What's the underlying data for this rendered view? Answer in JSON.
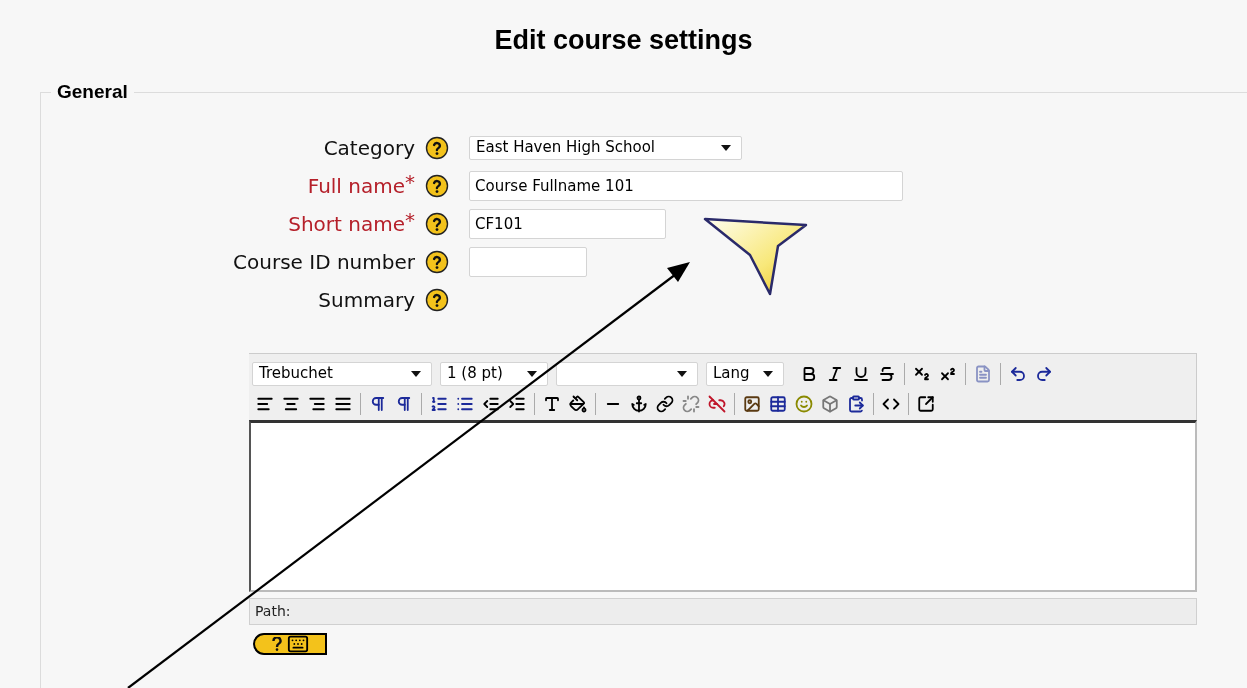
{
  "page_title": "Edit course settings",
  "section": {
    "legend": "General"
  },
  "fields": [
    {
      "kind": "select",
      "label": "Category",
      "required": false,
      "value": "East Haven High School"
    },
    {
      "kind": "text",
      "label": "Full name",
      "required": true,
      "required_mark": "*",
      "value": "Course Fullname 101"
    },
    {
      "kind": "text",
      "label": "Short name",
      "required": true,
      "required_mark": "*",
      "value": "CF101"
    },
    {
      "kind": "text",
      "label": "Course ID number",
      "required": false
    },
    {
      "kind": "editor",
      "label": "Summary",
      "required": false
    }
  ],
  "editor": {
    "font_select": "Trebuchet",
    "size_select": "1 (8 pt)",
    "lang_select": "Lang",
    "path_label": "Path:"
  }
}
